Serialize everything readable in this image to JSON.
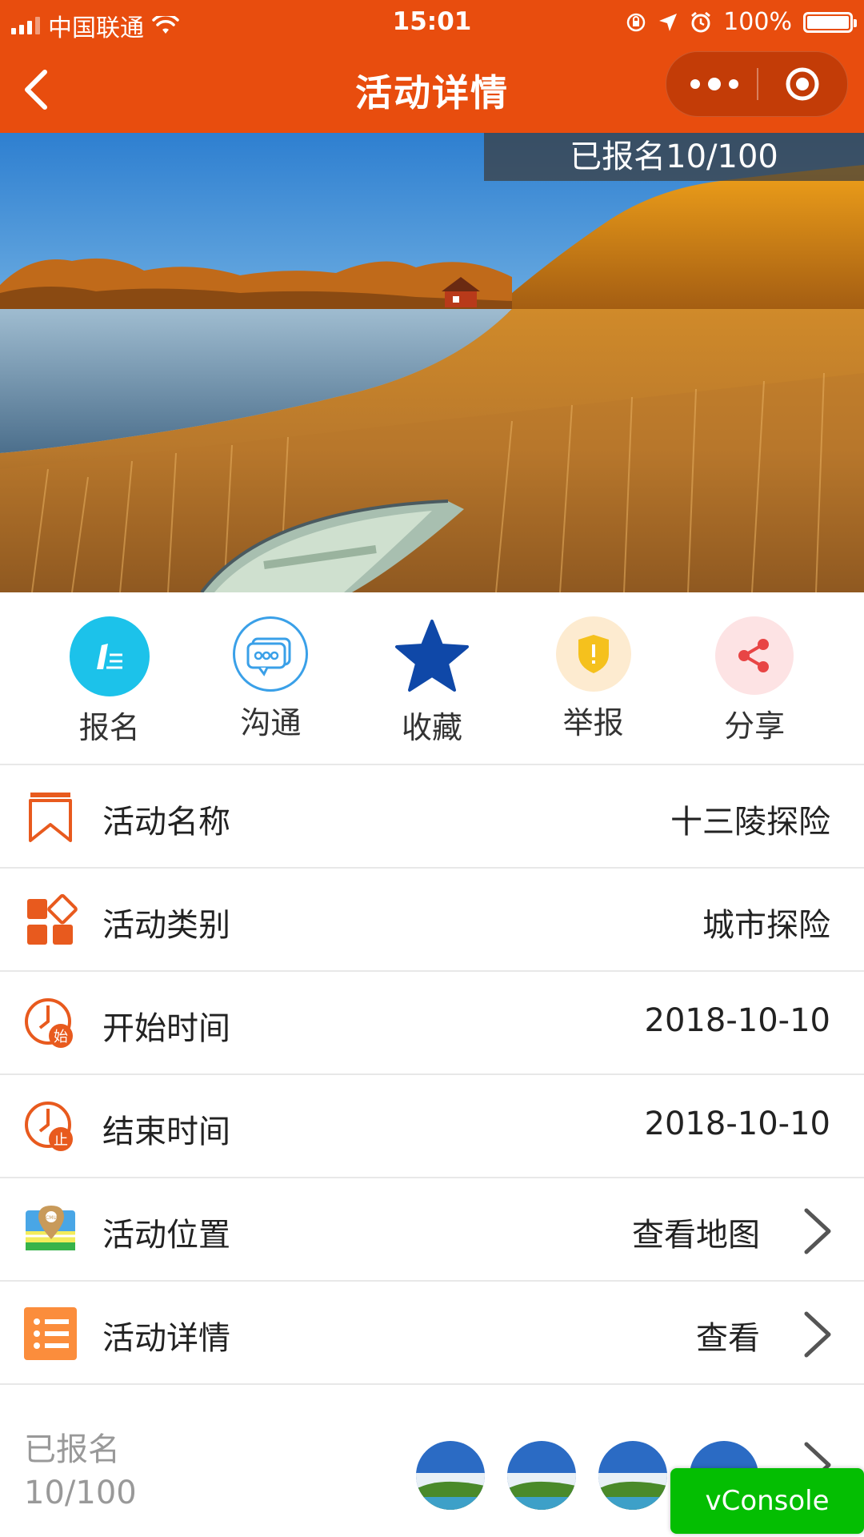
{
  "status_bar": {
    "carrier": "中国联通",
    "time": "15:01",
    "battery": "100%"
  },
  "nav": {
    "title": "活动详情"
  },
  "banner": {
    "registered_badge": "已报名10/100"
  },
  "actions": [
    {
      "label": "报名",
      "icon": "pen-icon",
      "color": "#1cc2ea"
    },
    {
      "label": "沟通",
      "icon": "chat-icon",
      "color": "#3aa0e8"
    },
    {
      "label": "收藏",
      "icon": "star-icon",
      "color": "#0f48a8"
    },
    {
      "label": "举报",
      "icon": "shield-icon",
      "color": "#f5c11d"
    },
    {
      "label": "分享",
      "icon": "share-icon",
      "color": "#e84545"
    }
  ],
  "rows": [
    {
      "label": "活动名称",
      "value": "十三陵探险",
      "icon": "bookmark-icon"
    },
    {
      "label": "活动类别",
      "value": "城市探险",
      "icon": "category-icon"
    },
    {
      "label": "开始时间",
      "value": "2018-10-10",
      "icon": "clock-start-icon",
      "badge": "始"
    },
    {
      "label": "结束时间",
      "value": "2018-10-10",
      "icon": "clock-end-icon",
      "badge": "止"
    },
    {
      "label": "活动位置",
      "value": "查看地图",
      "icon": "map-icon",
      "map_tag": "CMU"
    },
    {
      "label": "活动详情",
      "value": "查看",
      "icon": "list-icon"
    }
  ],
  "signup": {
    "label": "已报名",
    "count": "10/100"
  },
  "vconsole": {
    "label": "vConsole"
  },
  "colors": {
    "brand": "#e84d0e",
    "vconsole": "#04be02"
  }
}
